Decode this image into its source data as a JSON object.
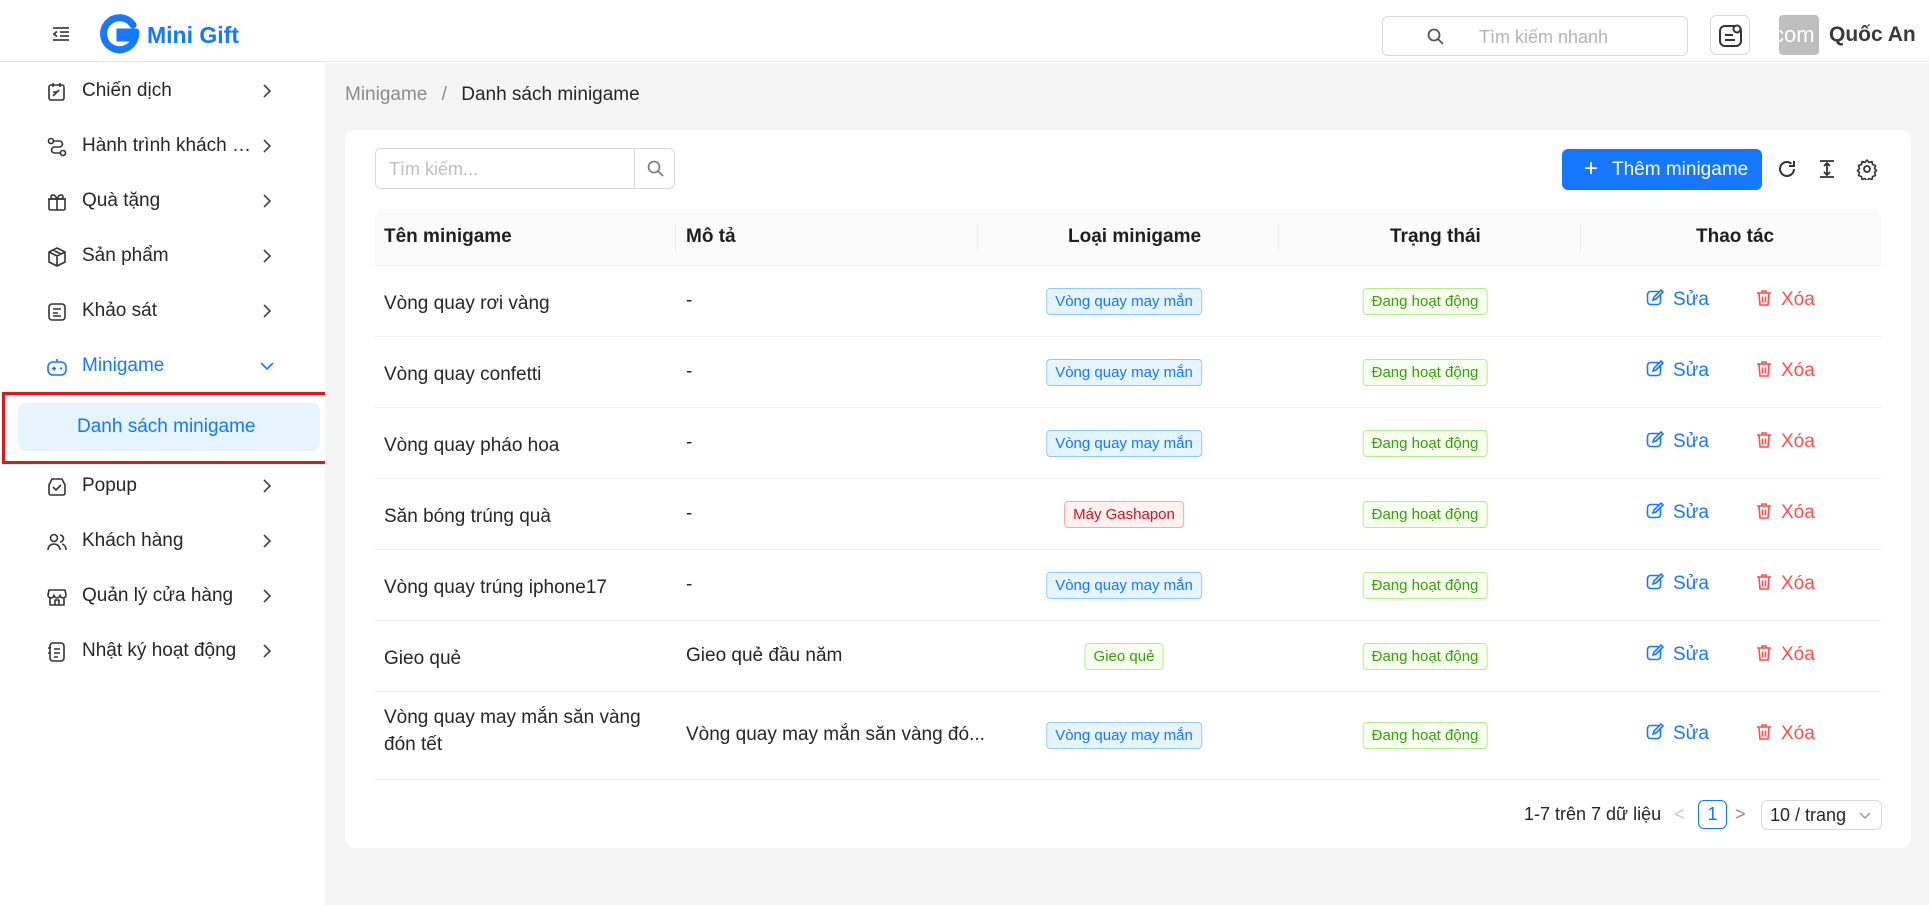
{
  "header": {
    "brand": "Mini Gift",
    "search_placeholder": "Tìm kiếm nhanh",
    "avatar_text": "com",
    "user_name": "Quốc An"
  },
  "sidebar": {
    "items": [
      {
        "label": "Chiến dịch",
        "icon": "calendar-edit-icon"
      },
      {
        "label": "Hành trình khách hàng",
        "icon": "route-icon"
      },
      {
        "label": "Quà tặng",
        "icon": "gift-icon"
      },
      {
        "label": "Sản phẩm",
        "icon": "box-icon"
      },
      {
        "label": "Khảo sát",
        "icon": "survey-icon"
      },
      {
        "label": "Minigame",
        "icon": "gamepad-icon",
        "active": true,
        "expanded": true
      },
      {
        "label": "Popup",
        "icon": "popup-icon"
      },
      {
        "label": "Khách hàng",
        "icon": "users-icon"
      },
      {
        "label": "Quản lý cửa hàng",
        "icon": "store-icon"
      },
      {
        "label": "Nhật ký hoạt động",
        "icon": "activity-log-icon"
      }
    ],
    "sub_active": "Danh sách minigame"
  },
  "breadcrumb": {
    "parent": "Minigame",
    "separator": "/",
    "current": "Danh sách minigame"
  },
  "toolbar": {
    "search_placeholder": "Tìm kiếm...",
    "add_label": "Thêm minigame"
  },
  "table": {
    "columns": [
      "Tên minigame",
      "Mô tả",
      "Loại minigame",
      "Trạng thái",
      "Thao tác"
    ],
    "rows": [
      {
        "name": "Vòng quay rơi vàng",
        "desc": "-",
        "type": "Vòng quay may mắn",
        "type_color": "blue",
        "status": "Đang hoạt động"
      },
      {
        "name": "Vòng quay confetti",
        "desc": "-",
        "type": "Vòng quay may mắn",
        "type_color": "blue",
        "status": "Đang hoạt động"
      },
      {
        "name": "Vòng quay pháo hoa",
        "desc": "-",
        "type": "Vòng quay may mắn",
        "type_color": "blue",
        "status": "Đang hoạt động"
      },
      {
        "name": "Săn bóng trúng quà",
        "desc": "-",
        "type": "Máy Gashapon",
        "type_color": "red",
        "status": "Đang hoạt động"
      },
      {
        "name": "Vòng quay trúng iphone17",
        "desc": "-",
        "type": "Vòng quay may mắn",
        "type_color": "blue",
        "status": "Đang hoạt động"
      },
      {
        "name": "Gieo quẻ",
        "desc": "Gieo quẻ đầu năm",
        "type": "Gieo quẻ",
        "type_color": "green",
        "status": "Đang hoạt động"
      },
      {
        "name": "Vòng quay may mắn săn vàng đón tết",
        "desc": "Vòng quay may mắn săn vàng đó...",
        "type": "Vòng quay may mắn",
        "type_color": "blue",
        "status": "Đang hoạt động"
      }
    ],
    "edit_label": "Sửa",
    "delete_label": "Xóa"
  },
  "pagination": {
    "info": "1-7 trên 7 dữ liệu",
    "prev": "<",
    "current_page": "1",
    "next": ">",
    "page_size": "10 / trang"
  },
  "colors": {
    "primary": "#1677ff",
    "danger": "#ff4d4f",
    "highlight_box": "#e0161b"
  }
}
